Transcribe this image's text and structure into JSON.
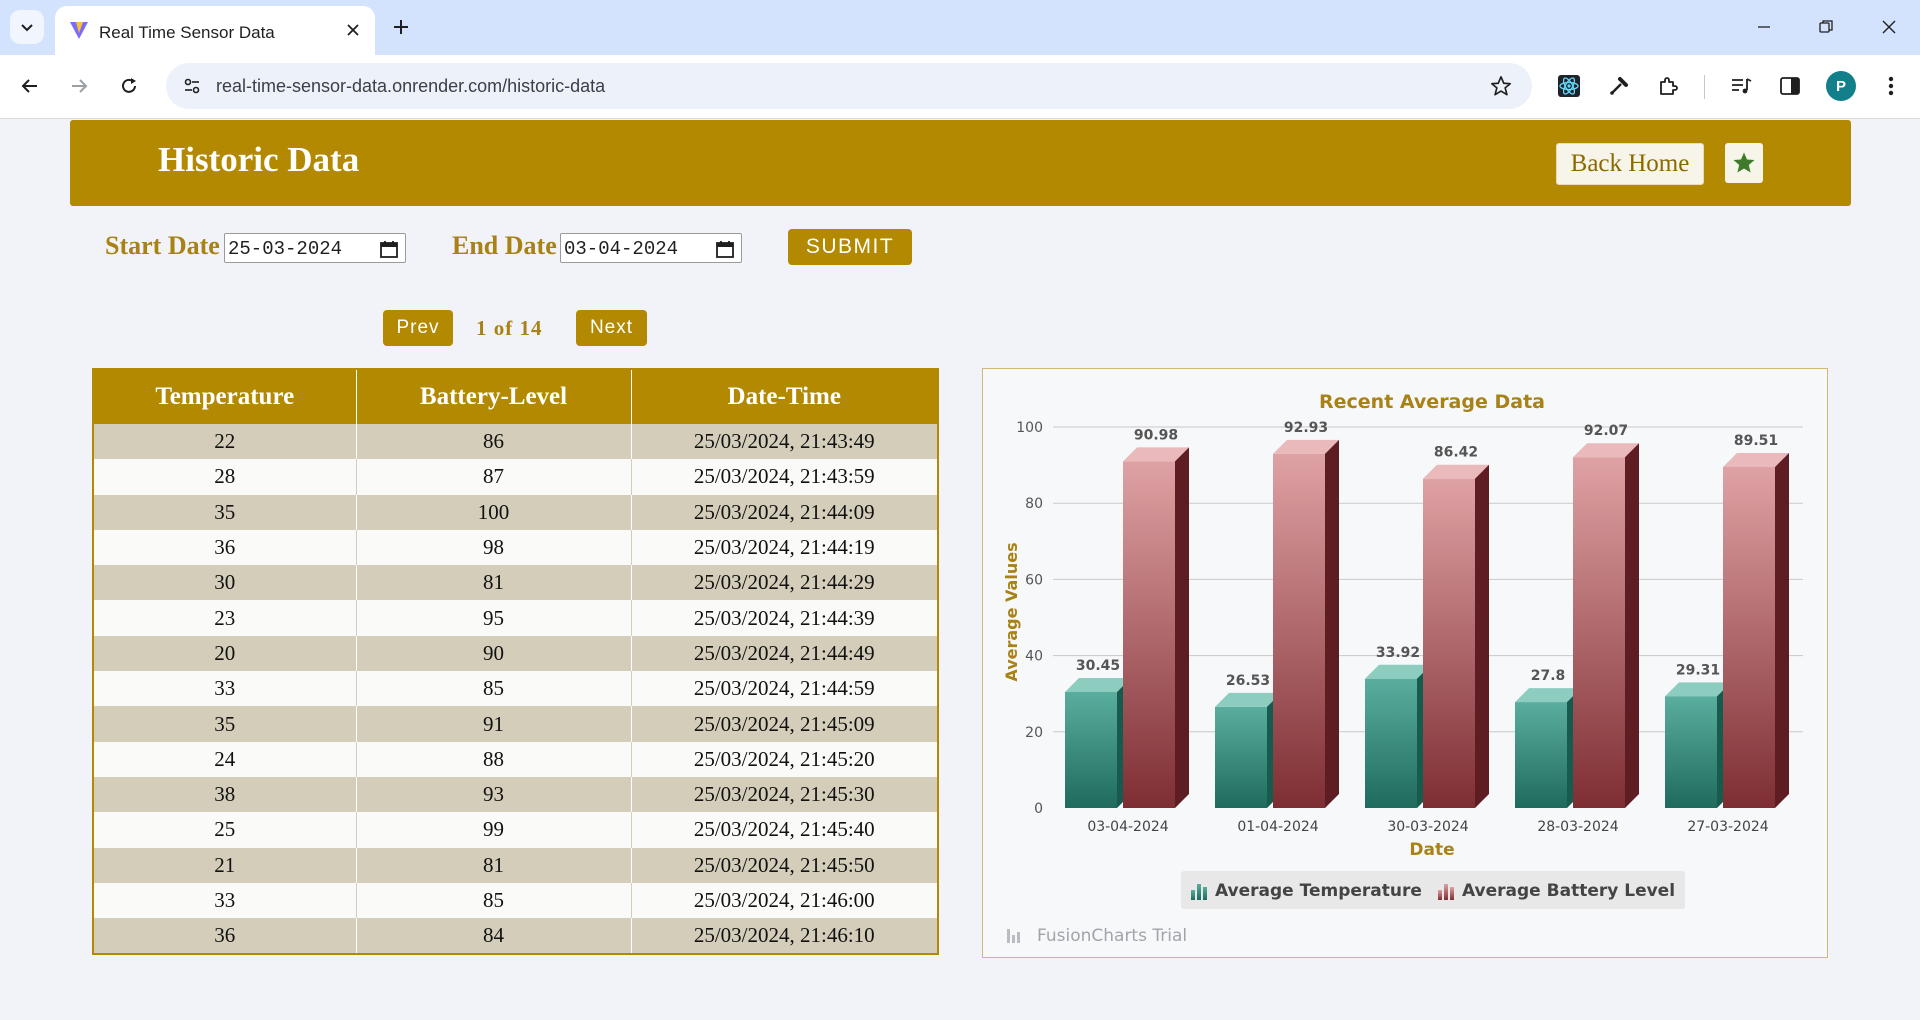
{
  "browser": {
    "tab_title": "Real Time Sensor Data",
    "url": "real-time-sensor-data.onrender.com/historic-data",
    "profile_initial": "P"
  },
  "header": {
    "title": "Historic Data",
    "back_home_label": "Back Home"
  },
  "filters": {
    "start_label": "Start Date",
    "start_value": "25-03-2024",
    "end_label": "End Date",
    "end_value": "03-04-2024",
    "submit_label": "SUBMIT"
  },
  "pagination": {
    "prev_label": "Prev",
    "indicator": "1 of 14",
    "next_label": "Next"
  },
  "table": {
    "columns": [
      "Temperature",
      "Battery-Level",
      "Date-Time"
    ],
    "rows": [
      [
        "22",
        "86",
        "25/03/2024, 21:43:49"
      ],
      [
        "28",
        "87",
        "25/03/2024, 21:43:59"
      ],
      [
        "35",
        "100",
        "25/03/2024, 21:44:09"
      ],
      [
        "36",
        "98",
        "25/03/2024, 21:44:19"
      ],
      [
        "30",
        "81",
        "25/03/2024, 21:44:29"
      ],
      [
        "23",
        "95",
        "25/03/2024, 21:44:39"
      ],
      [
        "20",
        "90",
        "25/03/2024, 21:44:49"
      ],
      [
        "33",
        "85",
        "25/03/2024, 21:44:59"
      ],
      [
        "35",
        "91",
        "25/03/2024, 21:45:09"
      ],
      [
        "24",
        "88",
        "25/03/2024, 21:45:20"
      ],
      [
        "38",
        "93",
        "25/03/2024, 21:45:30"
      ],
      [
        "25",
        "99",
        "25/03/2024, 21:45:40"
      ],
      [
        "21",
        "81",
        "25/03/2024, 21:45:50"
      ],
      [
        "33",
        "85",
        "25/03/2024, 21:46:00"
      ],
      [
        "36",
        "84",
        "25/03/2024, 21:46:10"
      ]
    ]
  },
  "chart_data": {
    "type": "bar",
    "title": "Recent Average Data",
    "xlabel": "Date",
    "ylabel": "Average Values",
    "ylim": [
      0,
      100
    ],
    "yticks": [
      0,
      20,
      40,
      60,
      80,
      100
    ],
    "categories": [
      "03-04-2024",
      "01-04-2024",
      "30-03-2024",
      "28-03-2024",
      "27-03-2024"
    ],
    "series": [
      {
        "name": "Average Temperature",
        "values": [
          30.45,
          26.53,
          33.92,
          27.8,
          29.31
        ],
        "color": "#3f9988"
      },
      {
        "name": "Average Battery Level",
        "values": [
          90.98,
          92.93,
          86.42,
          92.07,
          89.51
        ],
        "color": "#c97a7d"
      }
    ],
    "legend": "bottom",
    "grid": true,
    "watermark": "FusionCharts Trial"
  },
  "colors": {
    "gold": "#b28900",
    "gold_text": "#a88214",
    "row_shade": "#d3cdb9"
  }
}
